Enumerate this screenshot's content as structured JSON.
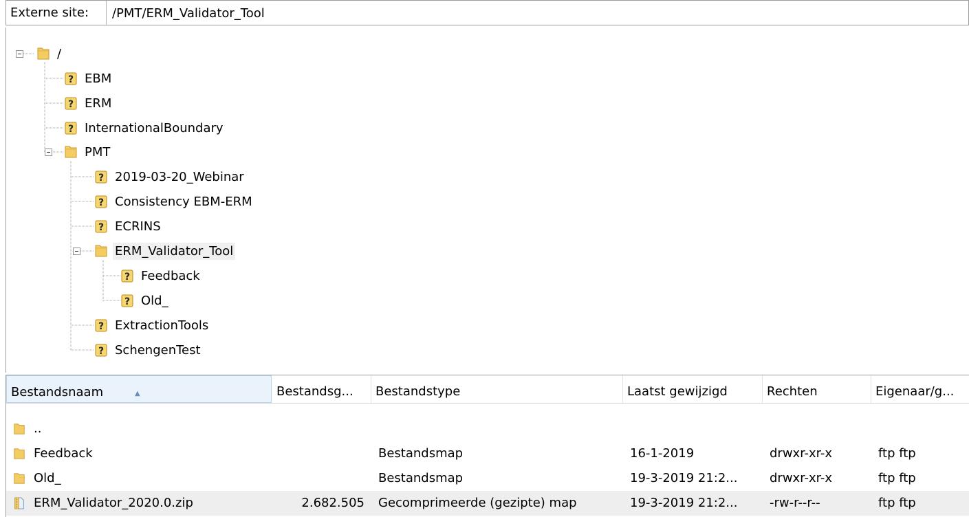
{
  "pathbar": {
    "label": "Externe site:",
    "path": "/PMT/ERM_Validator_Tool"
  },
  "tree": {
    "root": {
      "label": "/",
      "icon": "folder-icon"
    },
    "nodes": [
      {
        "label": "EBM",
        "icon": "unknown-folder-icon"
      },
      {
        "label": "ERM",
        "icon": "unknown-folder-icon"
      },
      {
        "label": "InternationalBoundary",
        "icon": "unknown-folder-icon"
      },
      {
        "label": "PMT",
        "icon": "folder-icon"
      },
      {
        "label": "2019-03-20_Webinar",
        "icon": "unknown-folder-icon"
      },
      {
        "label": "Consistency EBM-ERM",
        "icon": "unknown-folder-icon"
      },
      {
        "label": "ECRINS",
        "icon": "unknown-folder-icon"
      },
      {
        "label": "ERM_Validator_Tool",
        "icon": "folder-icon",
        "selected": true
      },
      {
        "label": "Feedback",
        "icon": "unknown-folder-icon"
      },
      {
        "label": "Old_",
        "icon": "unknown-folder-icon"
      },
      {
        "label": "ExtractionTools",
        "icon": "unknown-folder-icon"
      },
      {
        "label": "SchengenTest",
        "icon": "unknown-folder-icon"
      }
    ]
  },
  "filelist": {
    "columns": [
      "Bestandsnaam",
      "Bestandsg...",
      "Bestandstype",
      "Laatst gewijzigd",
      "Rechten",
      "Eigenaar/g..."
    ],
    "sorted_column": "Bestandsnaam",
    "rows": [
      {
        "name": "..",
        "size": "",
        "type": "",
        "modified": "",
        "perms": "",
        "owner": "",
        "icon": "folder-icon"
      },
      {
        "name": "Feedback",
        "size": "",
        "type": "Bestandsmap",
        "modified": "16-1-2019",
        "perms": "drwxr-xr-x",
        "owner": "ftp ftp",
        "icon": "folder-icon"
      },
      {
        "name": "Old_",
        "size": "",
        "type": "Bestandsmap",
        "modified": "19-3-2019 21:2...",
        "perms": "drwxr-xr-x",
        "owner": "ftp ftp",
        "icon": "folder-icon"
      },
      {
        "name": "ERM_Validator_2020.0.zip",
        "size": "2.682.505",
        "type": "Gecomprimeerde (gezipte) map",
        "modified": "19-3-2019 21:2...",
        "perms": "-rw-r--r--",
        "owner": "ftp ftp",
        "icon": "zip-file-icon",
        "highlighted": true
      }
    ]
  },
  "colors": {
    "folder": "#e8b84a",
    "unknown_badge": "#c89b1e",
    "selected_bg": "#f0f0f0",
    "sorted_header": "#eaf3fc"
  }
}
